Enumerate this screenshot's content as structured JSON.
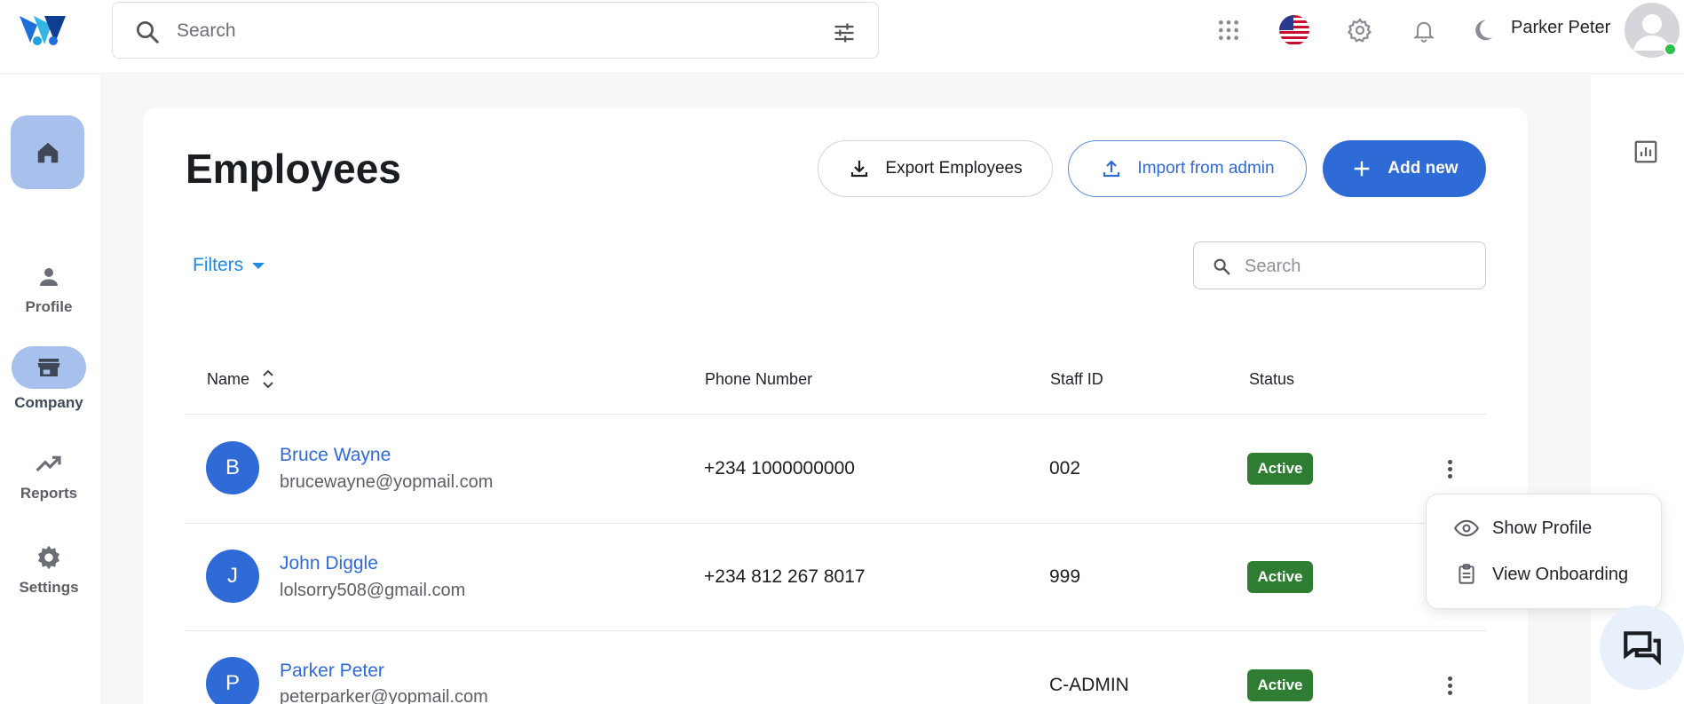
{
  "topbar": {
    "search_placeholder": "Search",
    "user_name": "Parker Peter",
    "icons": [
      "apps-grid-icon",
      "us-flag-icon",
      "settings-gear-icon",
      "notification-bell-icon",
      "dark-mode-moon-icon"
    ]
  },
  "sidebar": {
    "items": [
      {
        "name": "home",
        "label": ""
      },
      {
        "name": "profile",
        "label": "Profile"
      },
      {
        "name": "company",
        "label": "Company",
        "active": true
      },
      {
        "name": "reports",
        "label": "Reports"
      },
      {
        "name": "settings",
        "label": "Settings"
      }
    ]
  },
  "page": {
    "title": "Employees",
    "export_label": "Export Employees",
    "import_label": "Import from admin",
    "add_label": "Add new",
    "filters_label": "Filters",
    "search_placeholder": "Search"
  },
  "table": {
    "headers": [
      "Name",
      "Phone Number",
      "Staff ID",
      "Status"
    ],
    "rows": [
      {
        "initial": "B",
        "name": "Bruce Wayne",
        "email": "brucewayne@yopmail.com",
        "phone": "+234 1000000000",
        "staff_id": "002",
        "status": "Active"
      },
      {
        "initial": "J",
        "name": "John Diggle",
        "email": "lolsorry508@gmail.com",
        "phone": "+234 812 267 8017",
        "staff_id": "999",
        "status": "Active"
      },
      {
        "initial": "P",
        "name": "Parker Peter",
        "email": "peterparker@yopmail.com",
        "phone": "",
        "staff_id": "C-ADMIN",
        "status": "Active"
      }
    ]
  },
  "row_menu": {
    "items": [
      {
        "label": "Show Profile",
        "icon": "eye-icon"
      },
      {
        "label": "View Onboarding",
        "icon": "clipboard-icon"
      }
    ]
  },
  "colors": {
    "primary": "#2f6bd6",
    "active_badge": "#2e7d32",
    "sidebar_highlight": "#a8c1ec",
    "filters_link": "#1e88e5"
  }
}
